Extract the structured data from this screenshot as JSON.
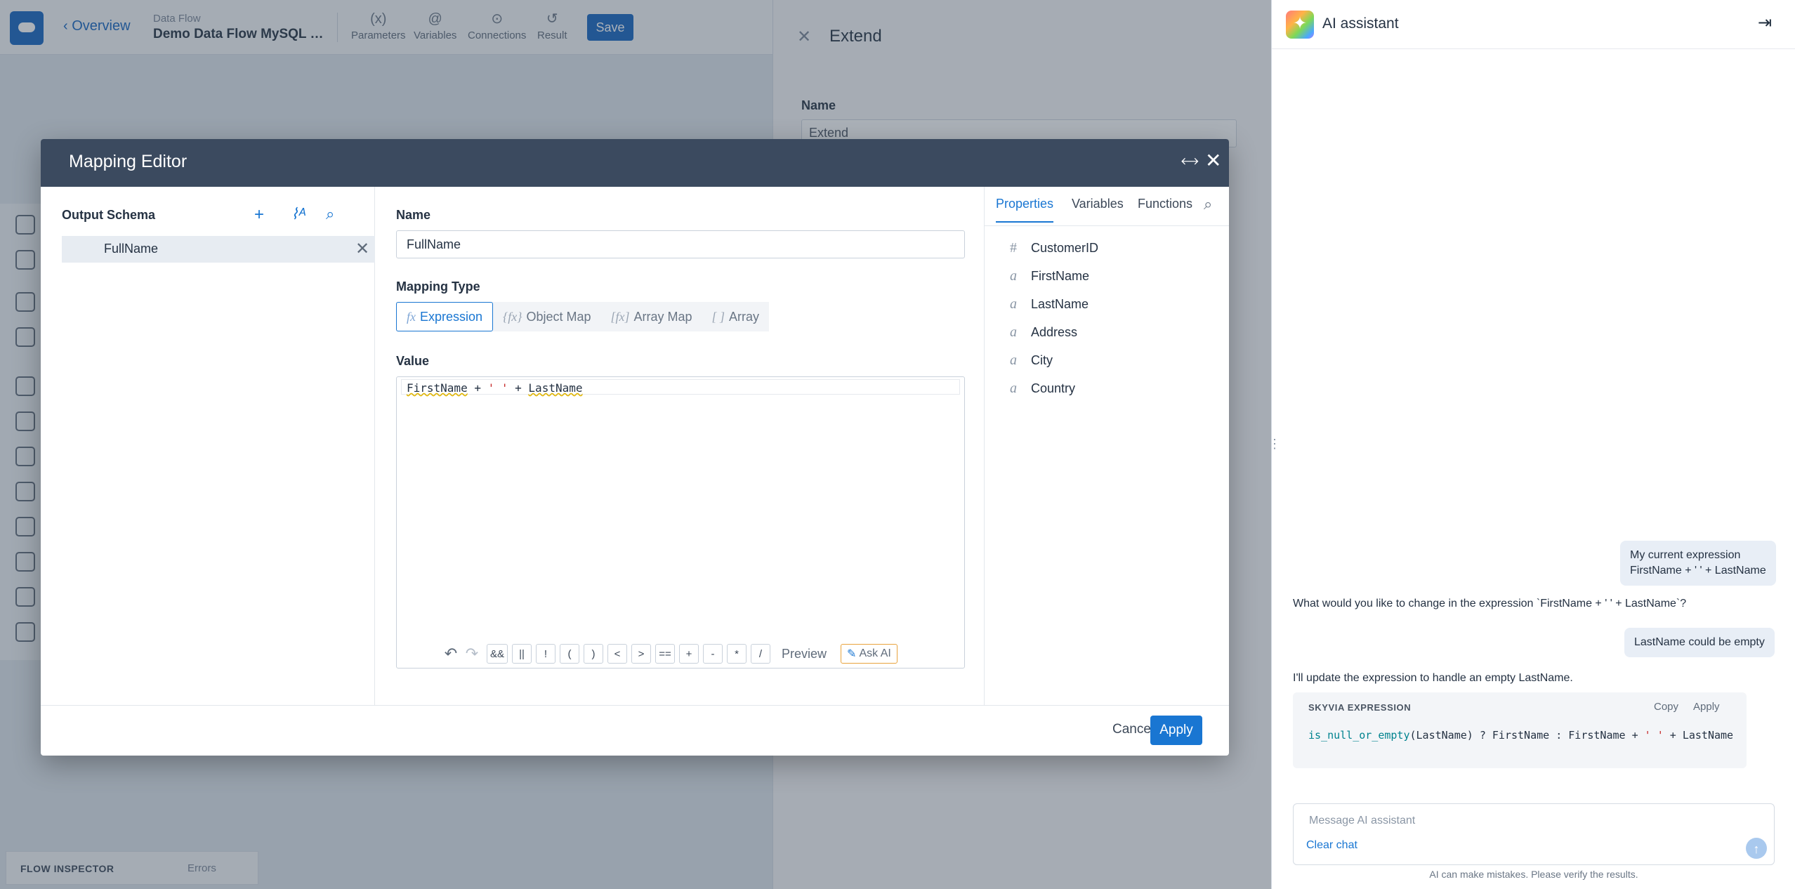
{
  "app": {
    "back_label": "Overview",
    "caption": "Data Flow",
    "title": "Demo Data Flow MySQL Sale...",
    "toolbar": [
      {
        "glyph": "(x)",
        "label": "Parameters"
      },
      {
        "glyph": "@",
        "label": "Variables"
      },
      {
        "glyph": "⊙",
        "label": "Connections"
      },
      {
        "glyph": "↺",
        "label": "Result"
      }
    ],
    "save_label": "Save",
    "side_panel": {
      "title": "Extend",
      "name_label": "Name",
      "name_value": "Extend"
    },
    "inspector": {
      "title": "FLOW INSPECTOR",
      "errors": "Errors"
    }
  },
  "modal": {
    "title": "Mapping Editor",
    "output_schema": {
      "title": "Output Schema",
      "items": [
        {
          "label": "FullName"
        }
      ]
    },
    "name_label": "Name",
    "name_value": "FullName",
    "mapping_type_label": "Mapping Type",
    "mapping_types": [
      {
        "glyph": "fx",
        "label": "Expression",
        "active": true
      },
      {
        "glyph": "{fx}",
        "label": "Object Map"
      },
      {
        "glyph": "[fx]",
        "label": "Array Map"
      },
      {
        "glyph": "[ ]",
        "label": "Array"
      }
    ],
    "value_label": "Value",
    "expression": {
      "a": "FirstName",
      "op1": " + ",
      "str": "' '",
      "op2": " + ",
      "b": "LastName"
    },
    "operators": [
      "&&",
      "||",
      "!",
      "(",
      ")",
      "<",
      ">",
      "==",
      "+",
      "-",
      "*",
      "/"
    ],
    "preview_label": "Preview",
    "ask_ai_label": "Ask AI",
    "tabs": [
      {
        "label": "Properties",
        "active": true
      },
      {
        "label": "Variables"
      },
      {
        "label": "Functions"
      }
    ],
    "properties": [
      {
        "type": "#",
        "name": "CustomerID"
      },
      {
        "type": "a",
        "name": "FirstName"
      },
      {
        "type": "a",
        "name": "LastName"
      },
      {
        "type": "a",
        "name": "Address"
      },
      {
        "type": "a",
        "name": "City"
      },
      {
        "type": "a",
        "name": "Country"
      }
    ],
    "cancel_label": "Cancel",
    "apply_label": "Apply"
  },
  "ai": {
    "title": "AI assistant",
    "user_msg_1_line1": "My current expression",
    "user_msg_1_line2": "FirstName + ' ' + LastName",
    "ai_reply_1": "What would you like to change in the expression `FirstName + ' ' + LastName`?",
    "user_msg_2": "LastName could be empty",
    "ai_reply_2": "I'll update the expression to handle an empty LastName.",
    "code_card": {
      "heading": "SKYVIA EXPRESSION",
      "copy_label": "Copy",
      "apply_label": "Apply",
      "fn": "is_null_or_empty",
      "mid": "(LastName) ? FirstName : FirstName + ",
      "str": "' '",
      "tail": " + LastName"
    },
    "input_placeholder": "Message AI assistant",
    "clear_chat_label": "Clear chat",
    "disclaimer": "AI can make mistakes. Please verify the results."
  }
}
